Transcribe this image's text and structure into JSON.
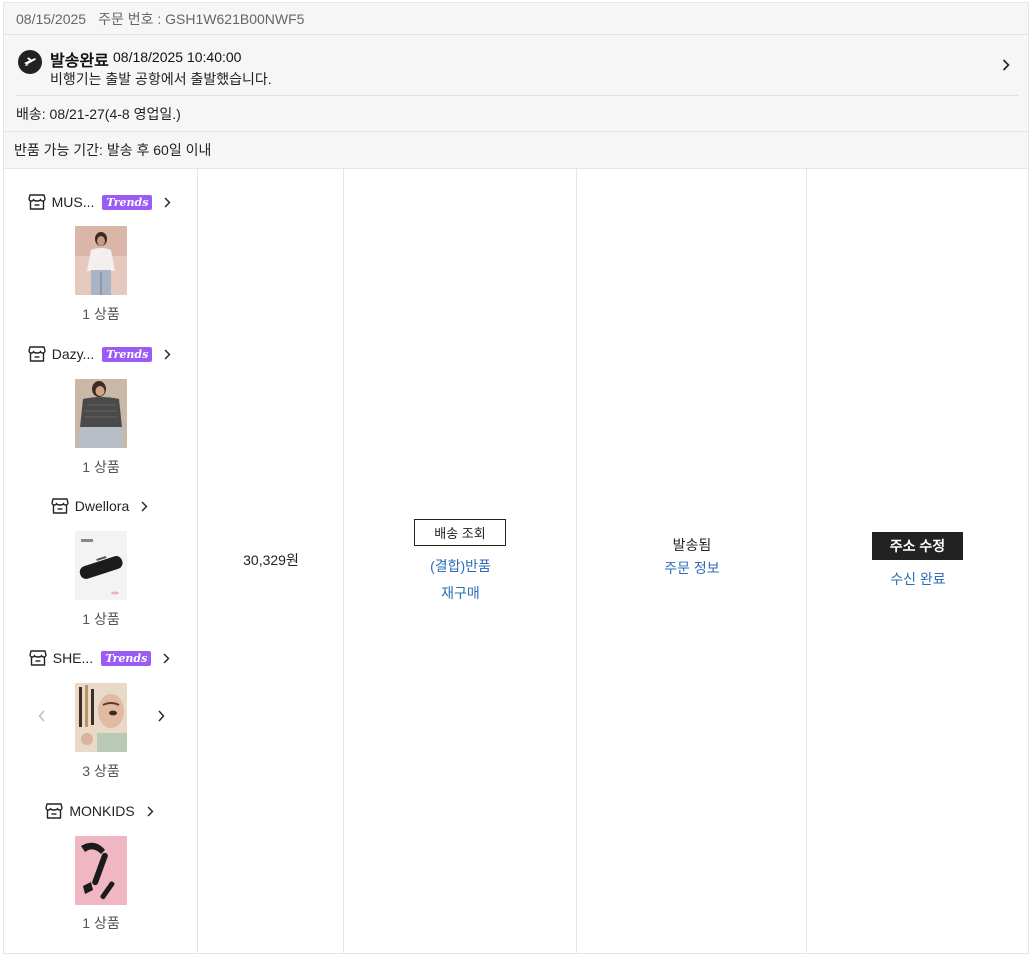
{
  "header": {
    "order_date": "08/15/2025",
    "order_number_label": "주문 번호 : GSH1W621B00NWF5"
  },
  "status": {
    "title": "발송완료",
    "time": "08/18/2025 10:40:00",
    "description": "비행기는 출발 공항에서 출발했습니다.",
    "delivery": "배송: 08/21-27(4-8 영업일.)"
  },
  "return_period": "반품 가능 기간: 발송 후 60일 이내",
  "stores": [
    {
      "name": "MUS...",
      "trends": "Trends",
      "count": "1 상품"
    },
    {
      "name": "Dazy...",
      "trends": "Trends",
      "count": "1 상품"
    },
    {
      "name": "Dwellora",
      "trends": "",
      "count": "1 상품"
    },
    {
      "name": "SHE...",
      "trends": "Trends",
      "count": "3 상품"
    },
    {
      "name": "MONKIDS",
      "trends": "",
      "count": "1 상품"
    }
  ],
  "price": "30,329원",
  "actions": {
    "track_label": "배송 조회",
    "return_label": "(결합)반품",
    "rebuy_label": "재구매"
  },
  "order_status": {
    "state": "발송됨",
    "info_link": "주문 정보"
  },
  "address": {
    "edit_label": "주소 수정",
    "received_label": "수신 완료"
  },
  "colors": {
    "trends_badge": "#9b5cf6",
    "link": "#2d6db5",
    "dark_button": "#222222"
  }
}
